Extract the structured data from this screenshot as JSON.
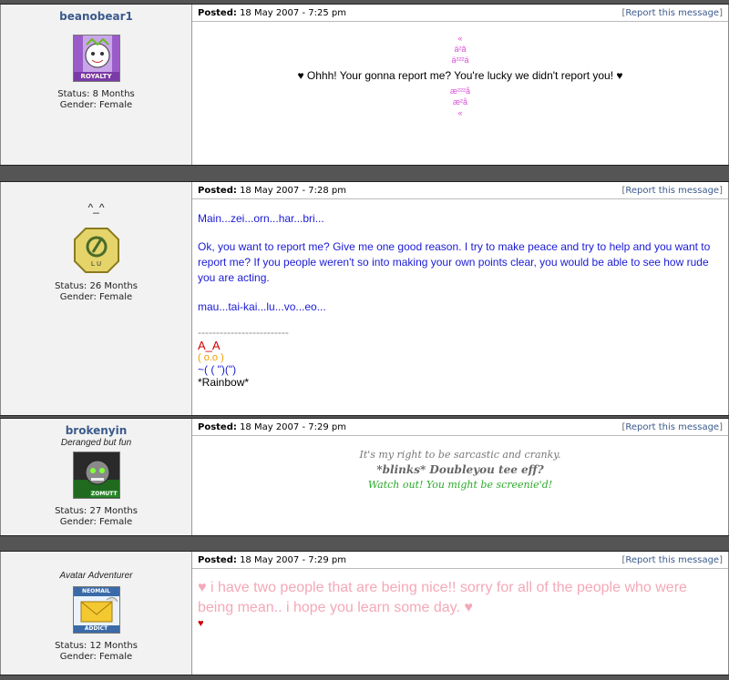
{
  "common": {
    "posted_label": "Posted:",
    "report_text": "Report this message"
  },
  "posts": [
    {
      "username": "beanobear1",
      "user_title": "",
      "avatar_badge": "ROYALTY",
      "status": "Status: 8 Months",
      "gender": "Gender: Female",
      "date": "18 May 2007 - 7:25 pm",
      "deco_lines": [
        "«",
        "ä²ã",
        "ä²²²ä",
        "",
        "æ²²²å",
        "æ²å",
        "«"
      ],
      "message": "♥ Ohhh! Your gonna report me? You're lucky we didn't report you! ♥"
    },
    {
      "username": "",
      "user_title": "^_^",
      "avatar_badge": "L U",
      "status": "Status: 26 Months",
      "gender": "Gender: Female",
      "date": "18 May 2007 - 7:28 pm",
      "para1": "Main...zei...orn...har...bri...",
      "para2": "Ok, you want to report me? Give me one good reason. I try to make peace and try to help and you want to report me? If you people weren't so into making your own points clear, you would be able to see how rude you are acting.",
      "para3": "mau...tai-kai...lu...vo...eo...",
      "sig_line": "-------------------------",
      "sig1": "A_A",
      "sig2": "( o.o )",
      "sig3": "~( ( \")(\")",
      "sig4": "*Rainbow*"
    },
    {
      "username": "brokenyin",
      "user_title": "Deranged but fun",
      "avatar_badge": "ZOMUTT",
      "status": "Status: 27 Months",
      "gender": "Gender: Female",
      "date": "18 May 2007 - 7:29 pm",
      "line1": "It's my right to be sarcastic and cranky.",
      "line2": "*blinks* Doubleyou tee eff?",
      "line3": "Watch out! You might be screenie'd!"
    },
    {
      "username": "",
      "user_title": "Avatar Adventurer",
      "avatar_badge_top": "NEOMAIL",
      "avatar_badge_bottom": "ADDICT",
      "status": "Status: 12 Months",
      "gender": "Gender: Female",
      "date": "18 May 2007 - 7:29 pm",
      "message": "♥ i have two people that are being nice!! sorry for all of the people who were being mean.. i hope you learn some day. ♥",
      "trailer": "♥"
    }
  ]
}
